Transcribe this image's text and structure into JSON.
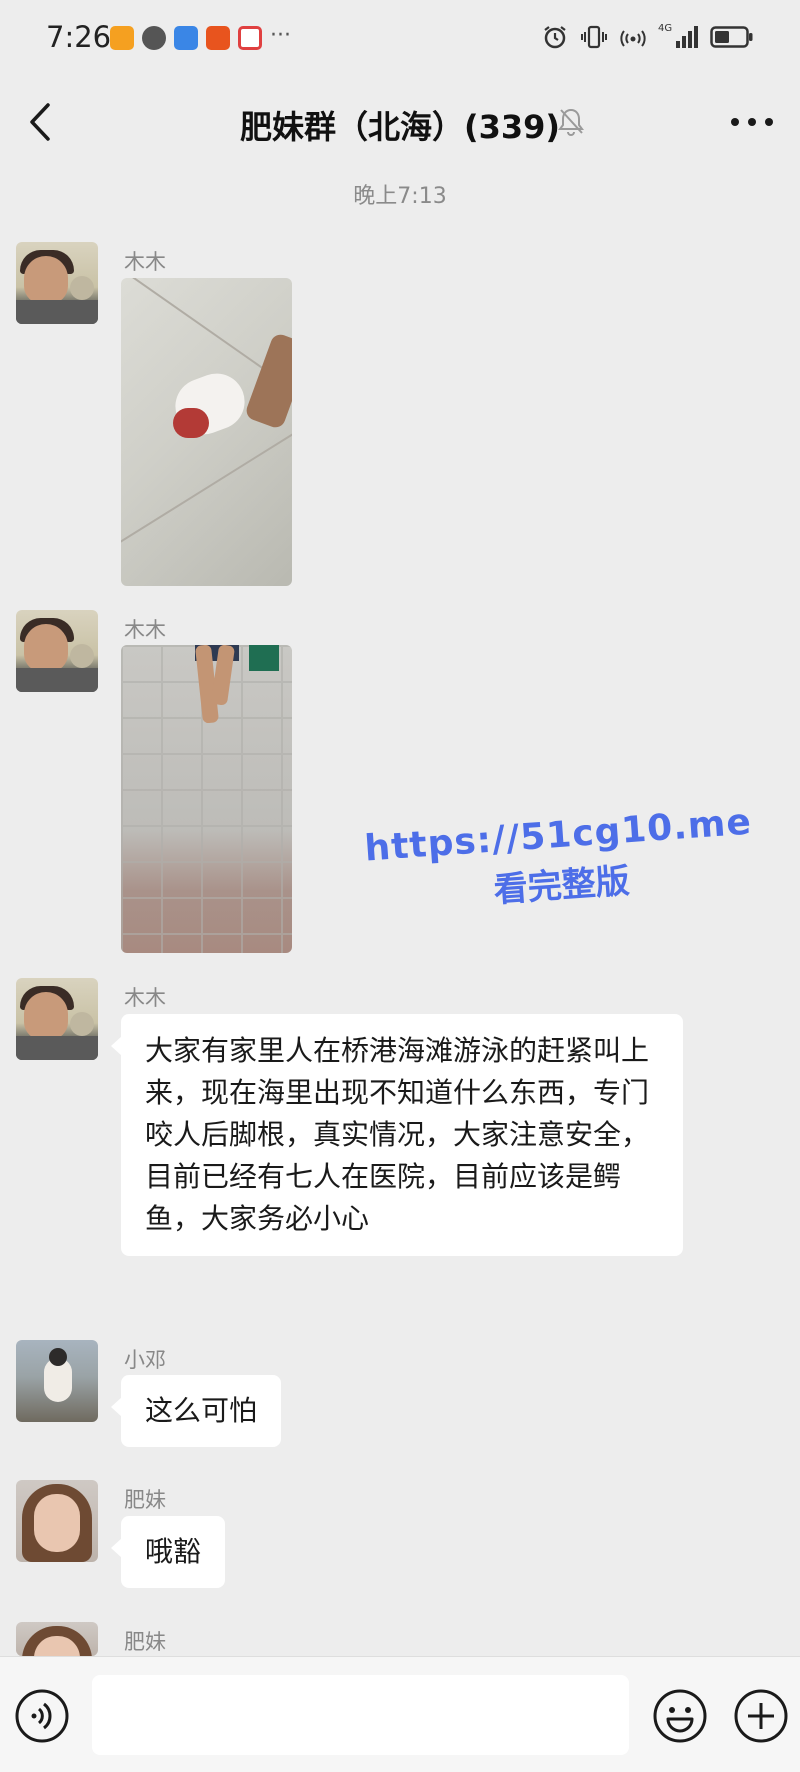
{
  "status_bar": {
    "time": "7:26",
    "network_label": "4G"
  },
  "nav": {
    "title": "肥妹群（北海）(339)"
  },
  "chat": {
    "timestamp": "晚上7:13",
    "messages": [
      {
        "sender": "木木",
        "type": "image"
      },
      {
        "sender": "木木",
        "type": "image"
      },
      {
        "sender": "木木",
        "type": "text",
        "text": "大家有家里人在桥港海滩游泳的赶紧叫上来，现在海里出现不知道什么东西，专门咬人后脚根，真实情况，大家注意安全，目前已经有七人在医院，目前应该是鳄鱼，大家务必小心"
      },
      {
        "sender": "小邓",
        "type": "text",
        "text": "这么可怕"
      },
      {
        "sender": "肥妹",
        "type": "text",
        "text": "哦豁"
      },
      {
        "sender": "肥妹",
        "type": "partial"
      }
    ]
  },
  "watermark": {
    "url": "https://51cg10.me",
    "subtitle": "看完整版"
  },
  "input_bar": {
    "placeholder": ""
  },
  "colors": {
    "background": "#ededed",
    "bubble": "#ffffff",
    "watermark": "#4d6ee8"
  }
}
